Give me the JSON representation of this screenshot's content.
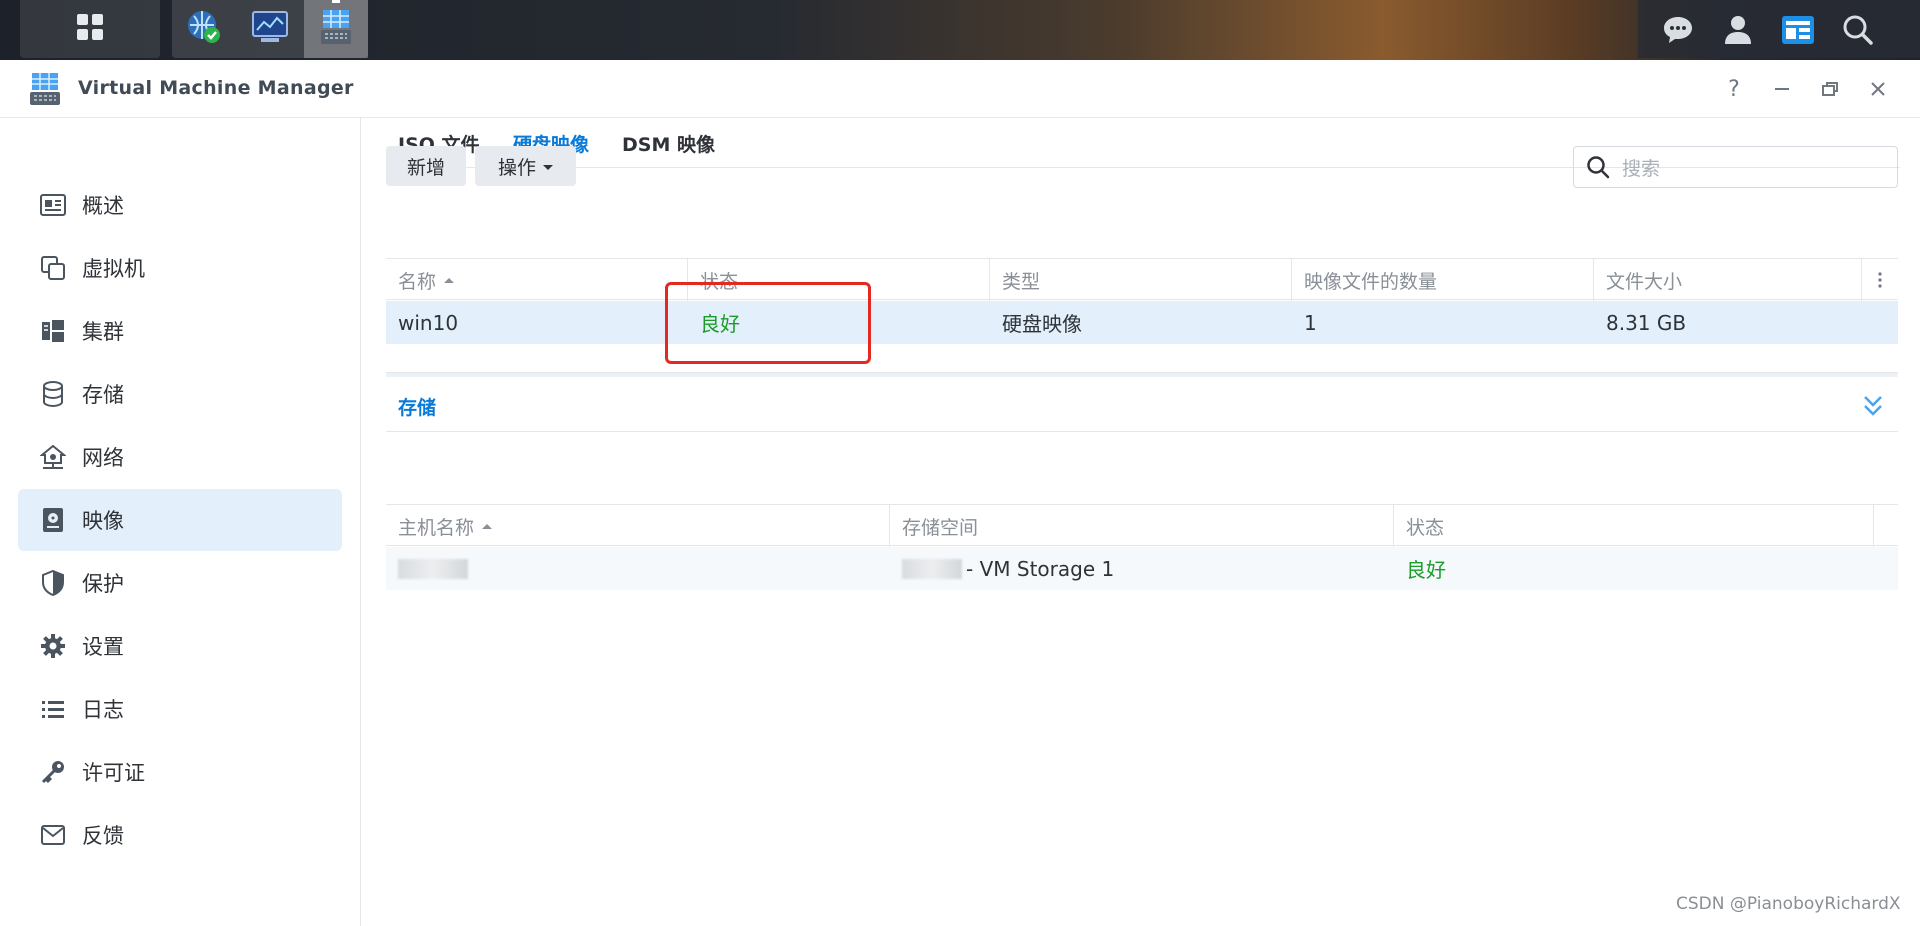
{
  "taskbar": {
    "start_icon": "grid-apps-icon",
    "apps": [
      {
        "name": "security-advisor",
        "icon": "globe-shield-icon"
      },
      {
        "name": "resource-monitor",
        "icon": "monitor-chart-icon"
      },
      {
        "name": "virtual-machine-manager",
        "icon": "vmm-icon"
      }
    ],
    "tray": [
      "chat-icon",
      "user-icon",
      "widgets-icon",
      "search-icon"
    ]
  },
  "window": {
    "title": "Virtual Machine Manager",
    "controls": {
      "help": "?",
      "minimize": "—",
      "restore": "❐",
      "close": "✕"
    }
  },
  "sidebar": {
    "items": [
      {
        "label": "概述",
        "icon": "overview-card-icon",
        "active": false
      },
      {
        "label": "虚拟机",
        "icon": "copy-windows-icon",
        "active": false
      },
      {
        "label": "集群",
        "icon": "cluster-icon",
        "active": false
      },
      {
        "label": "存储",
        "icon": "database-icon",
        "active": false
      },
      {
        "label": "网络",
        "icon": "network-icon",
        "active": false
      },
      {
        "label": "映像",
        "icon": "disk-image-icon",
        "active": true
      },
      {
        "label": "保护",
        "icon": "shield-icon",
        "active": false
      },
      {
        "label": "设置",
        "icon": "gear-icon",
        "active": false
      },
      {
        "label": "日志",
        "icon": "list-icon",
        "active": false
      },
      {
        "label": "许可证",
        "icon": "key-icon",
        "active": false
      },
      {
        "label": "反馈",
        "icon": "mail-icon",
        "active": false
      }
    ]
  },
  "tabs": [
    {
      "label": "ISO 文件",
      "active": false
    },
    {
      "label": "硬盘映像",
      "active": true
    },
    {
      "label": "DSM 映像",
      "active": false
    }
  ],
  "toolbar": {
    "add_label": "新增",
    "action_label": "操作",
    "search_placeholder": "搜索"
  },
  "images_table": {
    "columns": [
      "名称",
      "状态",
      "类型",
      "映像文件的数量",
      "文件大小"
    ],
    "rows": [
      {
        "name": "win10",
        "status": "良好",
        "type": "硬盘映像",
        "count": "1",
        "size": "8.31 GB"
      }
    ]
  },
  "storage_panel": {
    "tab_label": "存储",
    "columns": [
      "主机名称",
      "存储空间",
      "状态"
    ],
    "rows": [
      {
        "host": "",
        "volume": "- VM Storage 1",
        "status": "良好"
      }
    ]
  },
  "colors": {
    "accent": "#0a7ad8",
    "ok": "#1b9c2a",
    "highlight": "#e22a22",
    "active_nav": "#e3f0fc"
  },
  "watermark": "CSDN @PianoboyRichardX"
}
